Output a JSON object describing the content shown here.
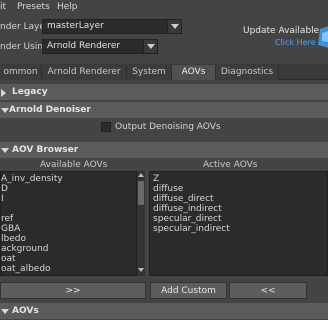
{
  "menubar": {
    "items": [
      "it",
      "Presets",
      "Help"
    ]
  },
  "header": {
    "render_layer_label": "nder Layer",
    "render_layer_value": "masterLayer",
    "render_using_label": "nder Using",
    "render_using_value": "Arnold Renderer",
    "update_title": "Update Available",
    "update_link": "Click Here"
  },
  "tabs": [
    {
      "label": "ommon",
      "active": false
    },
    {
      "label": "Arnold Renderer",
      "active": false
    },
    {
      "label": "System",
      "active": false
    },
    {
      "label": "AOVs",
      "active": true
    },
    {
      "label": "Diagnostics",
      "active": false
    }
  ],
  "frames": {
    "legacy": "Legacy",
    "denoiser": "Arnold Denoiser",
    "denoise_option": "Output Denoising AOVs",
    "browser": "AOV Browser",
    "aovs": "AOVs"
  },
  "browser": {
    "available_title": "Available AOVs",
    "active_title": "Active AOVs",
    "available": [
      "A_inv_density",
      "D",
      "I",
      "",
      "ref",
      "GBA",
      "lbedo",
      "ackground",
      "oat",
      "oat_albedo"
    ],
    "active": [
      "Z",
      "diffuse",
      "diffuse_direct",
      "diffuse_indirect",
      "specular_direct",
      "specular_indirect"
    ],
    "add_right_label": ">>",
    "add_custom_label": "Add Custom",
    "remove_label": "<<"
  },
  "colors": {
    "panel": "#444444",
    "frame_header": "#5b5b5b",
    "link": "#4aa3ff",
    "list_bg": "#2b2b2b"
  }
}
